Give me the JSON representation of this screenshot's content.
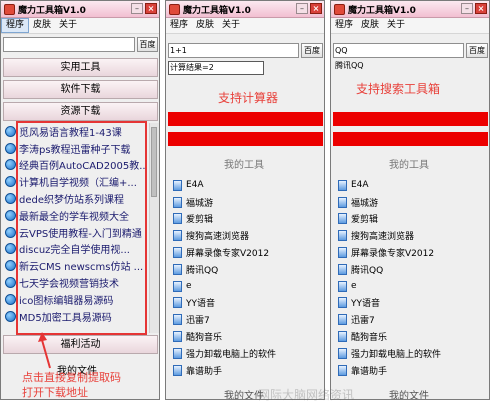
{
  "window1": {
    "title": "魔力工具箱V1.0",
    "menu": [
      "程序",
      "皮肤",
      "关于"
    ],
    "search": {
      "value": "",
      "button": "百度"
    },
    "nav": [
      "实用工具",
      "软件下载",
      "资源下载"
    ],
    "items": [
      "觅风易语言教程1-43课",
      "李涛ps教程迅雷种子下载",
      "经典百例AutoCAD2005教...",
      "计算机自学视频（汇编+...",
      "dede织梦仿站系列课程",
      "最新最全的学车视频大全",
      "云VPS使用教程-入门到精通",
      "discuz完全自学使用视...",
      "新云CMS newscms仿站 ...",
      "七天学会视频营销技术",
      "ico图标编辑器易源码",
      "MD5加密工具易源码"
    ],
    "welfare": "福利活动",
    "my_files": "我的文件"
  },
  "window2": {
    "title": "魔力工具箱V1.0",
    "menu": [
      "程序",
      "皮肤",
      "关于"
    ],
    "search": {
      "value": "1+1",
      "button": "百度"
    },
    "calc_result": "计算结果=2",
    "section": "我的工具",
    "items": [
      "E4A",
      "福城游",
      "爱剪辑",
      "搜狗高速浏览器",
      "屏幕录像专家V2012",
      "腾讯QQ",
      "e",
      "YY语音",
      "迅雷7",
      "酷狗音乐",
      "强力卸载电脑上的软件",
      "靠谱助手"
    ],
    "my_files": "我的文件"
  },
  "window3": {
    "title": "魔力工具箱V1.0",
    "menu": [
      "程序",
      "皮肤",
      "关于"
    ],
    "search": {
      "value": "QQ",
      "button": "百度"
    },
    "search_result": "腾讯QQ",
    "section": "我的工具",
    "items": [
      "E4A",
      "福城游",
      "爱剪辑",
      "搜狗高速浏览器",
      "屏幕录像专家V2012",
      "腾讯QQ",
      "e",
      "YY语音",
      "迅雷7",
      "酷狗音乐",
      "强力卸载电脑上的软件",
      "靠谱助手"
    ],
    "my_files": "我的文件"
  },
  "annotations": {
    "calculator": "支持计算器",
    "search_box": "支持搜索工具箱",
    "extract_line1": "点击直接复制提取码",
    "extract_line2": "打开下载地址"
  },
  "watermark": "网际大脑网络资讯",
  "colors": {
    "annotation": "#e8403a",
    "titlebar": "#f2bfd1",
    "accent_red": "#ec0000"
  },
  "icons": {
    "app": "toolbox-icon",
    "download_item": "ie-globe-icon",
    "tool_item": "document-icon"
  }
}
